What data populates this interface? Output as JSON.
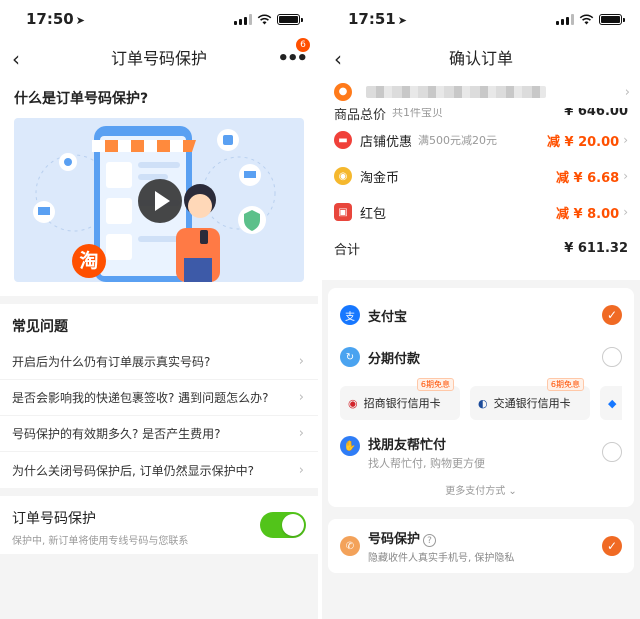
{
  "left": {
    "status": {
      "time": "17:50"
    },
    "nav": {
      "title": "订单号码保护",
      "badge": "6"
    },
    "intro": {
      "title": "什么是订单号码保护?",
      "logo_char": "淘"
    },
    "faq": {
      "title": "常见问题",
      "items": [
        "开启后为什么仍有订单展示真实号码?",
        "是否会影响我的快递包裹签收? 遇到问题怎么办?",
        "号码保护的有效期多久? 是否产生费用?",
        "为什么关闭号码保护后, 订单仍然显示保护中?"
      ]
    },
    "protect": {
      "title": "订单号码保护",
      "subtitle": "保护中, 新订单将使用专线号码与您联系",
      "enabled": true
    }
  },
  "right": {
    "status": {
      "time": "17:51"
    },
    "nav": {
      "title": "确认订单"
    },
    "price": {
      "goods_label": "商品总价",
      "goods_note": "共1件宝贝",
      "goods_amount": "¥ 646.00",
      "rows": [
        {
          "label": "店铺优惠",
          "note": "满500元减20元",
          "amount": "减 ¥ 20.00"
        },
        {
          "label": "淘金币",
          "note": "",
          "amount": "减 ¥ 6.68"
        },
        {
          "label": "红包",
          "note": "",
          "amount": "减 ¥ 8.00"
        }
      ],
      "total_label": "合计",
      "total_amount": "¥ 611.32"
    },
    "pay": {
      "alipay": "支付宝",
      "installment": "分期付款",
      "cards": [
        {
          "name": "招商银行信用卡",
          "tag": "6期免息"
        },
        {
          "name": "交通银行信用卡",
          "tag": "6期免息"
        },
        {
          "name": "花",
          "tag": ""
        }
      ],
      "friend_title": "找朋友帮忙付",
      "friend_sub": "找人帮忙付, 购物更方便",
      "more": "更多支付方式"
    },
    "number_protect": {
      "title": "号码保护",
      "help": "?",
      "subtitle": "隐藏收件人真实手机号, 保护隐私"
    }
  },
  "colors": {
    "accent": "#ff5000",
    "toggle_on": "#52c41a",
    "radio_on": "#f06a24"
  }
}
